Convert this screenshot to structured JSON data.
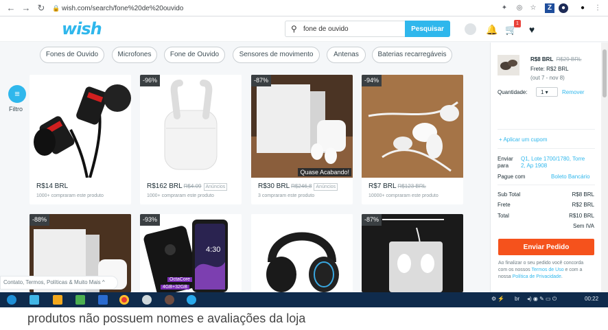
{
  "browser": {
    "url": "wish.com/search/fone%20de%20ouvido",
    "back_icon": "arrow-left-icon",
    "forward_icon": "arrow-right-icon",
    "reload_icon": "reload-icon"
  },
  "header": {
    "logo": "wish",
    "search_value": "fone de ouvido",
    "search_button": "Pesquisar",
    "cart_count": "1"
  },
  "chips": [
    "Fones de Ouvido",
    "Microfones",
    "Fone de Ouvido",
    "Sensores de movimento",
    "Antenas",
    "Baterias recarregáveis"
  ],
  "filter_label": "Filtro",
  "products": [
    {
      "discount": "",
      "price": "R$14 BRL",
      "old": "",
      "ads": "",
      "bought": "1000+ compraram este produto"
    },
    {
      "discount": "-96%",
      "price": "R$162 BRL",
      "old": "R$4.09",
      "ads": "Anúncios",
      "bought": "1000+ compraram este produto"
    },
    {
      "discount": "-87%",
      "price": "R$30 BRL",
      "old": "R$246,8",
      "ads": "Anúncios",
      "bought": "3 compraram este produto",
      "tag": "Quase Acabando!"
    },
    {
      "discount": "-94%",
      "price": "R$7 BRL",
      "old": "R$123 BRL",
      "ads": "",
      "bought": "10000+ compraram este produto"
    },
    {
      "discount": "-88%"
    },
    {
      "discount": "-93%",
      "badge1": "OctaCore",
      "badge2": "4GB+32GB",
      "phone_time": "4:30"
    },
    {
      "discount": ""
    },
    {
      "discount": "-87%"
    }
  ],
  "cart": {
    "price": "R$8 BRL",
    "old": "R$29 BRL",
    "shipping": "Frete: R$2 BRL",
    "delivery": "(out 7 - nov 8)",
    "qty_label": "Quantidade:",
    "qty": "1",
    "remove": "Remover",
    "coupon": "+ Aplicar um cupom",
    "ship_label1": "Enviar",
    "ship_label2": "para",
    "ship_addr1": "Q1, Lote 1700/1780, Torre",
    "ship_addr2": "2, Ap 1908",
    "pay_label": "Pague com",
    "pay_value": "Boleto Bancário",
    "subtotal_label": "Sub Total",
    "subtotal": "R$8 BRL",
    "frete_label": "Frete",
    "frete": "R$2 BRL",
    "total_label": "Total",
    "total": "R$10 BRL",
    "iva": "Sem IVA",
    "order_button": "Enviar Pedido",
    "terms1": "Ao finalizar o seu pedido você concorda",
    "terms2": "com os nossos",
    "terms_link1": "Termos de Uso",
    "terms3": "e com a",
    "terms4": "nossa",
    "terms_link2": "Política de Privacidade"
  },
  "footer_links": "Contato, Termos, Políticas & Muito Mais ^",
  "taskbar": {
    "lang": "br",
    "time": "00:22"
  },
  "caption": "produtos não possuem nomes e avaliações da loja"
}
